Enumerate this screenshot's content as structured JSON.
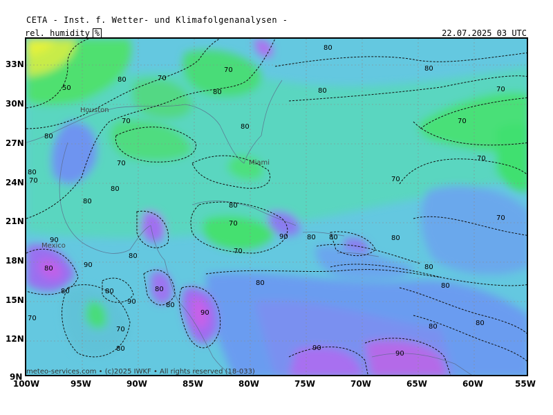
{
  "header": {
    "title": "CETA - Inst. f. Wetter- und Klimafolgenanalysen -",
    "parameter": "rel. humidity",
    "unit": "%",
    "valid_time": "22.07.2025 03 UTC"
  },
  "map": {
    "lat_labels": [
      "33N",
      "30N",
      "27N",
      "24N",
      "21N",
      "18N",
      "15N",
      "12N",
      "9N"
    ],
    "lon_labels": [
      "100W",
      "95W",
      "90W",
      "85W",
      "80W",
      "75W",
      "70W",
      "65W",
      "60W",
      "55W"
    ],
    "cities": [
      "Houston",
      "Miami",
      "Mexico"
    ],
    "contour_labels": [
      "50",
      "70",
      "80",
      "90"
    ],
    "colors": {
      "ocean_dry": "#6a9cf0",
      "mid": "#5fd8c8",
      "moist": "#46e07a",
      "very_dry": "#9a78f0",
      "driest": "#c860e8",
      "humid_high": "#d8f040"
    },
    "footer": "meteo-services.com • (c)2025 IWKF • All rights reserved (18-033)"
  }
}
